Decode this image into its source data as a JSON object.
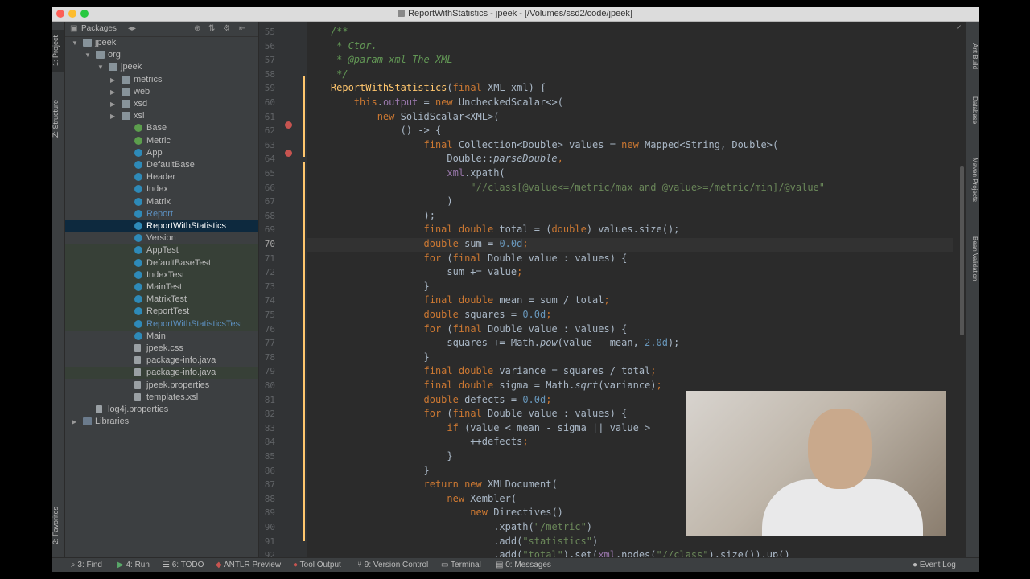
{
  "window": {
    "title": "ReportWithStatistics - jpeek - [/Volumes/ssd2/code/jpeek]"
  },
  "left_strip": [
    "1: Project",
    "Z: Structure",
    "2: Favorites"
  ],
  "project_panel": {
    "header_label": "Packages",
    "tree": [
      {
        "label": "jpeek",
        "indent": 0,
        "arrow": "▼",
        "icon": "folder-icon",
        "state": "",
        "color": "#bbbbbb"
      },
      {
        "label": "org",
        "indent": 1,
        "arrow": "▼",
        "icon": "folder-icon",
        "state": "",
        "color": "#bbbbbb"
      },
      {
        "label": "jpeek",
        "indent": 2,
        "arrow": "▼",
        "icon": "folder-icon",
        "state": "",
        "color": "#bbbbbb"
      },
      {
        "label": "metrics",
        "indent": 3,
        "arrow": "▶",
        "icon": "folder-icon",
        "state": "",
        "color": "#bbbbbb"
      },
      {
        "label": "web",
        "indent": 3,
        "arrow": "▶",
        "icon": "folder-icon",
        "state": "",
        "color": "#bbbbbb"
      },
      {
        "label": "xsd",
        "indent": 3,
        "arrow": "▶",
        "icon": "folder-icon",
        "state": "",
        "color": "#bbbbbb"
      },
      {
        "label": "xsl",
        "indent": 3,
        "arrow": "▶",
        "icon": "folder-icon",
        "state": "",
        "color": "#bbbbbb"
      },
      {
        "label": "Base",
        "indent": 4,
        "arrow": "",
        "icon": "interface-icon",
        "state": "",
        "color": "#bbbbbb"
      },
      {
        "label": "Metric",
        "indent": 4,
        "arrow": "",
        "icon": "interface-icon",
        "state": "",
        "color": "#bbbbbb"
      },
      {
        "label": "App",
        "indent": 4,
        "arrow": "",
        "icon": "class-icon",
        "state": "",
        "color": "#bbbbbb"
      },
      {
        "label": "DefaultBase",
        "indent": 4,
        "arrow": "",
        "icon": "class-icon",
        "state": "",
        "color": "#bbbbbb"
      },
      {
        "label": "Header",
        "indent": 4,
        "arrow": "",
        "icon": "class-icon",
        "state": "",
        "color": "#bbbbbb"
      },
      {
        "label": "Index",
        "indent": 4,
        "arrow": "",
        "icon": "class-icon",
        "state": "",
        "color": "#bbbbbb"
      },
      {
        "label": "Matrix",
        "indent": 4,
        "arrow": "",
        "icon": "class-icon",
        "state": "",
        "color": "#bbbbbb"
      },
      {
        "label": "Report",
        "indent": 4,
        "arrow": "",
        "icon": "class-icon",
        "state": "",
        "color": "#5c8fbf"
      },
      {
        "label": "ReportWithStatistics",
        "indent": 4,
        "arrow": "",
        "icon": "class-icon",
        "state": "selected",
        "color": "#ffffff"
      },
      {
        "label": "Version",
        "indent": 4,
        "arrow": "",
        "icon": "class-icon",
        "state": "",
        "color": "#bbbbbb"
      },
      {
        "label": "AppTest",
        "indent": 4,
        "arrow": "",
        "icon": "class-icon",
        "state": "green",
        "color": "#bbbbbb"
      },
      {
        "label": "DefaultBaseTest",
        "indent": 4,
        "arrow": "",
        "icon": "class-icon",
        "state": "green",
        "color": "#bbbbbb"
      },
      {
        "label": "IndexTest",
        "indent": 4,
        "arrow": "",
        "icon": "class-icon",
        "state": "green",
        "color": "#bbbbbb"
      },
      {
        "label": "MainTest",
        "indent": 4,
        "arrow": "",
        "icon": "class-icon",
        "state": "green",
        "color": "#bbbbbb"
      },
      {
        "label": "MatrixTest",
        "indent": 4,
        "arrow": "",
        "icon": "class-icon",
        "state": "green",
        "color": "#bbbbbb"
      },
      {
        "label": "ReportTest",
        "indent": 4,
        "arrow": "",
        "icon": "class-icon",
        "state": "green",
        "color": "#bbbbbb"
      },
      {
        "label": "ReportWithStatisticsTest",
        "indent": 4,
        "arrow": "",
        "icon": "class-icon",
        "state": "green",
        "color": "#5c8fbf"
      },
      {
        "label": "Main",
        "indent": 4,
        "arrow": "",
        "icon": "class-icon",
        "state": "",
        "color": "#bbbbbb"
      },
      {
        "label": "jpeek.css",
        "indent": 4,
        "arrow": "",
        "icon": "file-icon",
        "state": "",
        "color": "#bbbbbb"
      },
      {
        "label": "package-info.java",
        "indent": 4,
        "arrow": "",
        "icon": "file-icon",
        "state": "",
        "color": "#bbbbbb"
      },
      {
        "label": "package-info.java",
        "indent": 4,
        "arrow": "",
        "icon": "file-icon",
        "state": "green",
        "color": "#bbbbbb"
      },
      {
        "label": "jpeek.properties",
        "indent": 4,
        "arrow": "",
        "icon": "file-icon",
        "state": "",
        "color": "#bbbbbb"
      },
      {
        "label": "templates.xsl",
        "indent": 4,
        "arrow": "",
        "icon": "file-icon",
        "state": "",
        "color": "#bbbbbb"
      },
      {
        "label": "log4j.properties",
        "indent": 1,
        "arrow": "",
        "icon": "file-icon",
        "state": "",
        "color": "#bbbbbb"
      },
      {
        "label": "Libraries",
        "indent": 0,
        "arrow": "▶",
        "icon": "library-icon",
        "state": "",
        "color": "#bbbbbb"
      }
    ]
  },
  "line_numbers": [
    "55",
    "56",
    "57",
    "58",
    "59",
    "60",
    "61",
    "62",
    "63",
    "64",
    "65",
    "66",
    "67",
    "68",
    "69",
    "70",
    "71",
    "72",
    "73",
    "74",
    "75",
    "76",
    "77",
    "78",
    "79",
    "80",
    "81",
    "82",
    "83",
    "84",
    "85",
    "86",
    "87",
    "88",
    "89",
    "90",
    "91",
    "92"
  ],
  "code_lines": [
    [
      {
        "t": "    /**",
        "c": "com"
      }
    ],
    [
      {
        "t": "     * Ctor.",
        "c": "com"
      }
    ],
    [
      {
        "t": "     * @param ",
        "c": "com"
      },
      {
        "t": "xml",
        "c": "com"
      },
      {
        "t": " The XML",
        "c": "com"
      }
    ],
    [
      {
        "t": "     */",
        "c": "com"
      }
    ],
    [
      {
        "t": "    ",
        "c": ""
      },
      {
        "t": "ReportWithStatistics",
        "c": "fn"
      },
      {
        "t": "(",
        "c": ""
      },
      {
        "t": "final ",
        "c": "kw"
      },
      {
        "t": "XML xml) {",
        "c": ""
      }
    ],
    [
      {
        "t": "        ",
        "c": ""
      },
      {
        "t": "this",
        "c": "kw"
      },
      {
        "t": ".",
        "c": ""
      },
      {
        "t": "output",
        "c": "fld"
      },
      {
        "t": " = ",
        "c": ""
      },
      {
        "t": "new ",
        "c": "kw"
      },
      {
        "t": "UncheckedScalar<>(",
        "c": ""
      }
    ],
    [
      {
        "t": "            ",
        "c": ""
      },
      {
        "t": "new ",
        "c": "kw"
      },
      {
        "t": "SolidScalar<XML>(",
        "c": ""
      }
    ],
    [
      {
        "t": "                () -> {",
        "c": ""
      }
    ],
    [
      {
        "t": "                    ",
        "c": ""
      },
      {
        "t": "final ",
        "c": "kw"
      },
      {
        "t": "Collection<Double> values = ",
        "c": ""
      },
      {
        "t": "new ",
        "c": "kw"
      },
      {
        "t": "Mapped<String, Double>(",
        "c": ""
      }
    ],
    [
      {
        "t": "                        Double::",
        "c": ""
      },
      {
        "t": "parseDouble",
        "c": "ital"
      },
      {
        "t": ",",
        "c": "kw"
      }
    ],
    [
      {
        "t": "                        ",
        "c": ""
      },
      {
        "t": "xml",
        "c": "fld"
      },
      {
        "t": ".xpath(",
        "c": ""
      }
    ],
    [
      {
        "t": "                            ",
        "c": ""
      },
      {
        "t": "\"//class[@value<=/metric/max and @value>=/metric/min]/@value\"",
        "c": "str"
      }
    ],
    [
      {
        "t": "                        )",
        "c": ""
      }
    ],
    [
      {
        "t": "                    );",
        "c": ""
      }
    ],
    [
      {
        "t": "                    ",
        "c": ""
      },
      {
        "t": "final double ",
        "c": "kw"
      },
      {
        "t": "total = (",
        "c": ""
      },
      {
        "t": "double",
        "c": "kw"
      },
      {
        "t": ") values.size();",
        "c": ""
      }
    ],
    [
      {
        "t": "                    ",
        "c": ""
      },
      {
        "t": "double ",
        "c": "kw"
      },
      {
        "t": "sum = ",
        "c": ""
      },
      {
        "t": "0.0d",
        "c": "num"
      },
      {
        "t": ";",
        "c": "kw"
      }
    ],
    [
      {
        "t": "                    ",
        "c": ""
      },
      {
        "t": "for ",
        "c": "kw"
      },
      {
        "t": "(",
        "c": ""
      },
      {
        "t": "final ",
        "c": "kw"
      },
      {
        "t": "Double value : values) {",
        "c": ""
      }
    ],
    [
      {
        "t": "                        sum += value",
        "c": ""
      },
      {
        "t": ";",
        "c": "kw"
      }
    ],
    [
      {
        "t": "                    }",
        "c": ""
      }
    ],
    [
      {
        "t": "                    ",
        "c": ""
      },
      {
        "t": "final double ",
        "c": "kw"
      },
      {
        "t": "mean = sum / total",
        "c": ""
      },
      {
        "t": ";",
        "c": "kw"
      }
    ],
    [
      {
        "t": "                    ",
        "c": ""
      },
      {
        "t": "double ",
        "c": "kw"
      },
      {
        "t": "squares = ",
        "c": ""
      },
      {
        "t": "0.0d",
        "c": "num"
      },
      {
        "t": ";",
        "c": "kw"
      }
    ],
    [
      {
        "t": "                    ",
        "c": ""
      },
      {
        "t": "for ",
        "c": "kw"
      },
      {
        "t": "(",
        "c": ""
      },
      {
        "t": "final ",
        "c": "kw"
      },
      {
        "t": "Double value : values) {",
        "c": ""
      }
    ],
    [
      {
        "t": "                        squares += Math.",
        "c": ""
      },
      {
        "t": "pow",
        "c": "ital"
      },
      {
        "t": "(value - mean, ",
        "c": ""
      },
      {
        "t": "2.0d",
        "c": "num"
      },
      {
        "t": ");",
        "c": ""
      }
    ],
    [
      {
        "t": "                    }",
        "c": ""
      }
    ],
    [
      {
        "t": "                    ",
        "c": ""
      },
      {
        "t": "final double ",
        "c": "kw"
      },
      {
        "t": "variance = squares / total",
        "c": ""
      },
      {
        "t": ";",
        "c": "kw"
      }
    ],
    [
      {
        "t": "                    ",
        "c": ""
      },
      {
        "t": "final double ",
        "c": "kw"
      },
      {
        "t": "sigma = Math.",
        "c": ""
      },
      {
        "t": "sqrt",
        "c": "ital"
      },
      {
        "t": "(variance)",
        "c": ""
      },
      {
        "t": ";",
        "c": "kw"
      }
    ],
    [
      {
        "t": "                    ",
        "c": ""
      },
      {
        "t": "double ",
        "c": "kw"
      },
      {
        "t": "defects = ",
        "c": ""
      },
      {
        "t": "0.0d",
        "c": "num"
      },
      {
        "t": ";",
        "c": "kw"
      }
    ],
    [
      {
        "t": "                    ",
        "c": ""
      },
      {
        "t": "for ",
        "c": "kw"
      },
      {
        "t": "(",
        "c": ""
      },
      {
        "t": "final ",
        "c": "kw"
      },
      {
        "t": "Double value : values) {",
        "c": ""
      }
    ],
    [
      {
        "t": "                        ",
        "c": ""
      },
      {
        "t": "if ",
        "c": "kw"
      },
      {
        "t": "(value < mean - sigma || value >",
        "c": ""
      }
    ],
    [
      {
        "t": "                            ++defects",
        "c": ""
      },
      {
        "t": ";",
        "c": "kw"
      }
    ],
    [
      {
        "t": "                        }",
        "c": ""
      }
    ],
    [
      {
        "t": "                    }",
        "c": ""
      }
    ],
    [
      {
        "t": "                    ",
        "c": ""
      },
      {
        "t": "return new ",
        "c": "kw"
      },
      {
        "t": "XMLDocument(",
        "c": ""
      }
    ],
    [
      {
        "t": "                        ",
        "c": ""
      },
      {
        "t": "new ",
        "c": "kw"
      },
      {
        "t": "Xembler(",
        "c": ""
      }
    ],
    [
      {
        "t": "                            ",
        "c": ""
      },
      {
        "t": "new ",
        "c": "kw"
      },
      {
        "t": "Directives()",
        "c": ""
      }
    ],
    [
      {
        "t": "                                .xpath(",
        "c": ""
      },
      {
        "t": "\"/metric\"",
        "c": "str"
      },
      {
        "t": ")",
        "c": ""
      }
    ],
    [
      {
        "t": "                                .add(",
        "c": ""
      },
      {
        "t": "\"statistics\"",
        "c": "str"
      },
      {
        "t": ")",
        "c": ""
      }
    ],
    [
      {
        "t": "                                .add(",
        "c": ""
      },
      {
        "t": "\"total\"",
        "c": "str"
      },
      {
        "t": ").set(",
        "c": ""
      },
      {
        "t": "xml",
        "c": "fld"
      },
      {
        "t": ".nodes(",
        "c": ""
      },
      {
        "t": "\"//class\"",
        "c": "str"
      },
      {
        "t": ").size()).up()",
        "c": ""
      }
    ]
  ],
  "right_strip": [
    "Ant Build",
    "Database",
    "Maven Projects",
    "Bean Validation"
  ],
  "bottom_bar": {
    "find": "3: Find",
    "run": "4: Run",
    "todo": "6: TODO",
    "antlr": "ANTLR Preview",
    "tool_output": "Tool Output",
    "vcs": "9: Version Control",
    "terminal": "Terminal",
    "messages": "0: Messages",
    "event_log": "Event Log"
  }
}
